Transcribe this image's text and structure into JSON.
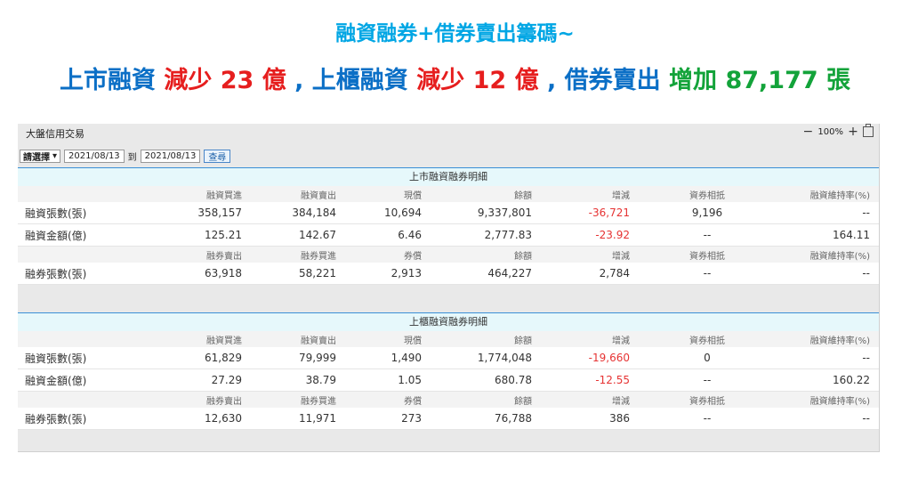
{
  "headline": {
    "line1": "融資融券+借券賣出籌碼~",
    "line2": [
      {
        "text": "上市融資 ",
        "color": "blue"
      },
      {
        "text": "減少 23 億",
        "color": "red"
      },
      {
        "text": " , 上櫃融資 ",
        "color": "blue"
      },
      {
        "text": "減少 12 億",
        "color": "red"
      },
      {
        "text": " ,  借券賣出 ",
        "color": "blue"
      },
      {
        "text": "增加 87,177 張",
        "color": "green"
      }
    ]
  },
  "panel": {
    "title": "大盤信用交易",
    "zoom_level": "100%",
    "zoom_out": "−",
    "zoom_in": "+",
    "filter": {
      "select_value": "請選擇",
      "date_from": "2021/08/13",
      "to_label": "到",
      "date_to": "2021/08/13",
      "query_label": "查尋"
    }
  },
  "sections": [
    {
      "title": "上市融資融券明細",
      "margin_headers": [
        "融資買進",
        "融資賣出",
        "現償",
        "餘額",
        "增減",
        "資券相抵",
        "融資維持率(%)"
      ],
      "margin_rows": [
        {
          "label": "融資張數(張)",
          "values": [
            "358,157",
            "384,184",
            "10,694",
            "9,337,801",
            "-36,721",
            "9,196",
            "--"
          ]
        },
        {
          "label": "融資金額(億)",
          "values": [
            "125.21",
            "142.67",
            "6.46",
            "2,777.83",
            "-23.92",
            "--",
            "164.11"
          ]
        }
      ],
      "short_headers": [
        "融券賣出",
        "融券買進",
        "券償",
        "餘額",
        "增減",
        "資券相抵",
        "融資維持率(%)"
      ],
      "short_rows": [
        {
          "label": "融券張數(張)",
          "values": [
            "63,918",
            "58,221",
            "2,913",
            "464,227",
            "2,784",
            "--",
            "--"
          ]
        }
      ]
    },
    {
      "title": "上櫃融資融券明細",
      "margin_headers": [
        "融資買進",
        "融資賣出",
        "現償",
        "餘額",
        "增減",
        "資券相抵",
        "融資維持率(%)"
      ],
      "margin_rows": [
        {
          "label": "融資張數(張)",
          "values": [
            "61,829",
            "79,999",
            "1,490",
            "1,774,048",
            "-19,660",
            "0",
            "--"
          ]
        },
        {
          "label": "融資金額(億)",
          "values": [
            "27.29",
            "38.79",
            "1.05",
            "680.78",
            "-12.55",
            "--",
            "160.22"
          ]
        }
      ],
      "short_headers": [
        "融券賣出",
        "融券買進",
        "券償",
        "餘額",
        "增減",
        "資券相抵",
        "融資維持率(%)"
      ],
      "short_rows": [
        {
          "label": "融券張數(張)",
          "values": [
            "12,630",
            "11,971",
            "273",
            "76,788",
            "386",
            "--",
            "--"
          ]
        }
      ]
    }
  ]
}
